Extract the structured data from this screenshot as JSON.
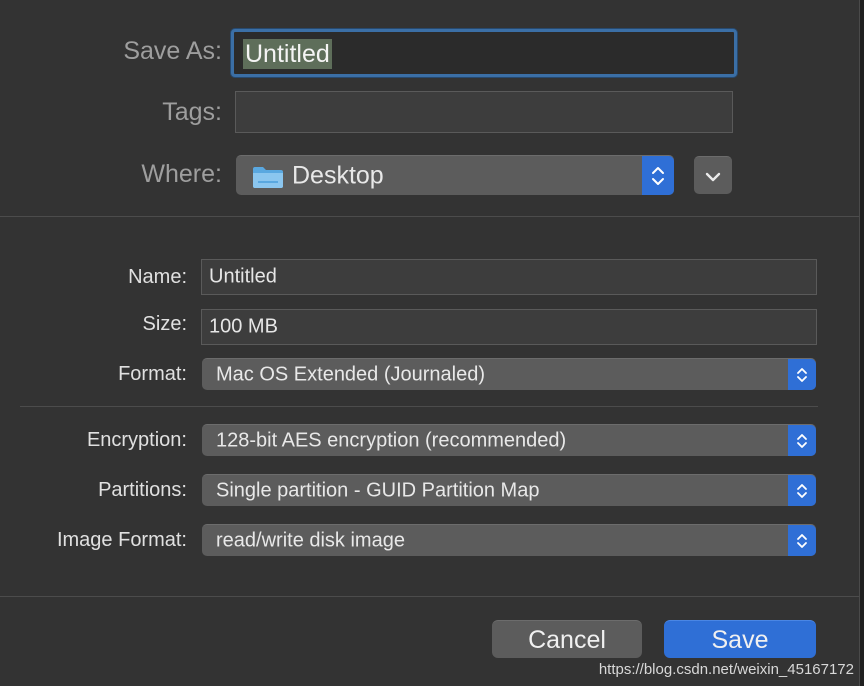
{
  "top": {
    "save_as_label": "Save As:",
    "save_as_value": "Untitled",
    "tags_label": "Tags:",
    "tags_value": "",
    "where_label": "Where:",
    "where_value": "Desktop",
    "where_icon": "folder-icon",
    "expand_icon": "chevron-down-icon"
  },
  "options": {
    "name_label": "Name:",
    "name_value": "Untitled",
    "size_label": "Size:",
    "size_value": "100 MB",
    "format_label": "Format:",
    "format_value": "Mac OS Extended (Journaled)",
    "encryption_label": "Encryption:",
    "encryption_value": "128-bit AES encryption (recommended)",
    "partitions_label": "Partitions:",
    "partitions_value": "Single partition - GUID Partition Map",
    "image_format_label": "Image Format:",
    "image_format_value": "read/write disk image"
  },
  "buttons": {
    "cancel": "Cancel",
    "save": "Save"
  },
  "watermark": "https://blog.csdn.net/weixin_45167172",
  "colors": {
    "accent": "#2f6fd6",
    "background": "#333333",
    "field": "#3d3d3d",
    "popup": "#5c5c5c"
  }
}
